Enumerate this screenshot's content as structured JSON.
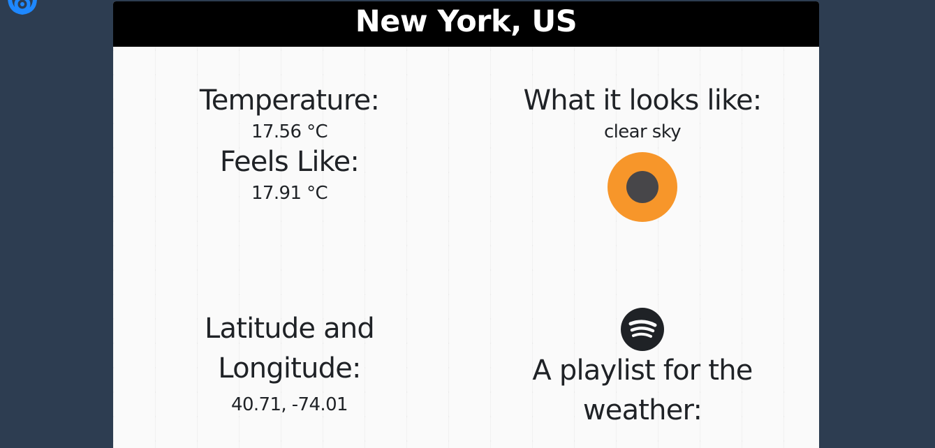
{
  "header": {
    "city": "New York, US"
  },
  "temperature": {
    "label": "Temperature:",
    "value": "17.56 °C"
  },
  "feels_like": {
    "label": "Feels Like:",
    "value": "17.91 °C"
  },
  "conditions": {
    "label": "What it looks like:",
    "description": "clear sky",
    "icon": "clear-sky-icon"
  },
  "coordinates": {
    "label_line1": "Latitude and",
    "label_line2": "Longitude:",
    "value": "40.71, -74.01"
  },
  "playlist": {
    "icon": "spotify-icon",
    "label_line1": "A playlist for the",
    "label_line2": "weather:"
  },
  "colors": {
    "page_background": "#2d3d51",
    "header_background": "#000000",
    "sun_outer": "#f7962a",
    "sun_inner": "#474649",
    "logo_blue": "#1e88ff"
  }
}
